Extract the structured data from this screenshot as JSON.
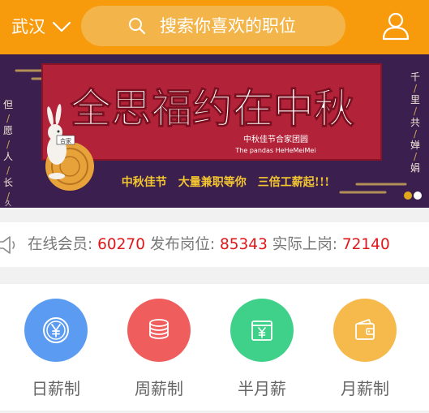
{
  "header": {
    "city": "武汉",
    "search_placeholder": "搜索你喜欢的职位"
  },
  "banner": {
    "title": "全思福约在中秋",
    "subtitle_cn": "中秋佳节合家团圆",
    "subtitle_en": "The pandas HeHeMeiMei",
    "tagline": "中秋佳节　大量兼职等你　三倍工薪起!!!",
    "left_poem": [
      "但",
      "愿",
      "人",
      "长",
      "久"
    ],
    "right_poem": [
      "千",
      "里",
      "共",
      "婵",
      "娟"
    ],
    "rabbit_sign": "合家",
    "slide_count": 2,
    "active_slide": 1
  },
  "stats": {
    "members_label": "在线会员: ",
    "members_value": "60270",
    "posted_label": "发布岗位: ",
    "posted_value": "85343",
    "hired_label": "实际上岗: ",
    "hired_value": "72140"
  },
  "categories": [
    {
      "label": "日薪制",
      "icon": "yen-coin-icon",
      "color": "#5b9cf2"
    },
    {
      "label": "周薪制",
      "icon": "coin-stack-icon",
      "color": "#f05d5d"
    },
    {
      "label": "半月薪",
      "icon": "wallet-yen-icon",
      "color": "#3fd18a"
    },
    {
      "label": "月薪制",
      "icon": "wallet-icon",
      "color": "#f5b94c"
    }
  ]
}
